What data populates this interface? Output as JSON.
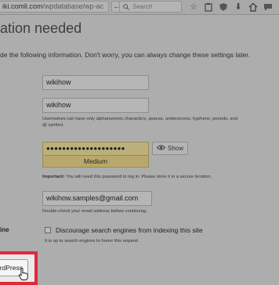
{
  "browser": {
    "url_domain": "iki.comli.com",
    "url_path": "/wpdatabase/wp-ac",
    "search_placeholder": "Search",
    "icons": [
      "back-arrow",
      "search-icon",
      "star-icon",
      "clipboard-icon",
      "shield-icon",
      "download-icon",
      "home-icon",
      "chat-icon"
    ]
  },
  "page": {
    "title": "ation needed",
    "intro": "de the following information. Don't worry, you can always change these settings later."
  },
  "form": {
    "site_title_value": "wikihow",
    "username_value": "wikihow",
    "username_hint_line1": "Usernames can have only alphanumeric characters, spaces, underscores, hyphens, periods, and",
    "username_hint_line2": "@ symbol.",
    "password_value": "●●●●●●●●●●●●●●●●●●●●",
    "strength_label": "Medium",
    "show_label": "Show",
    "password_hint_strong": "Important:",
    "password_hint_rest": " You will need this password to log in. Please store it in a secure location.",
    "email_value": "wikihow.samples@gmail.com",
    "email_hint": "Double-check your email address before continuing.",
    "visibility_label": "ine",
    "discourage_label": "Discourage search engines from indexing this site",
    "discourage_hint": "It is up to search engines to honor this request.",
    "install_label": "rdPress"
  },
  "colors": {
    "highlight": "#e0283d",
    "strength_bg": "#b8a86b"
  }
}
